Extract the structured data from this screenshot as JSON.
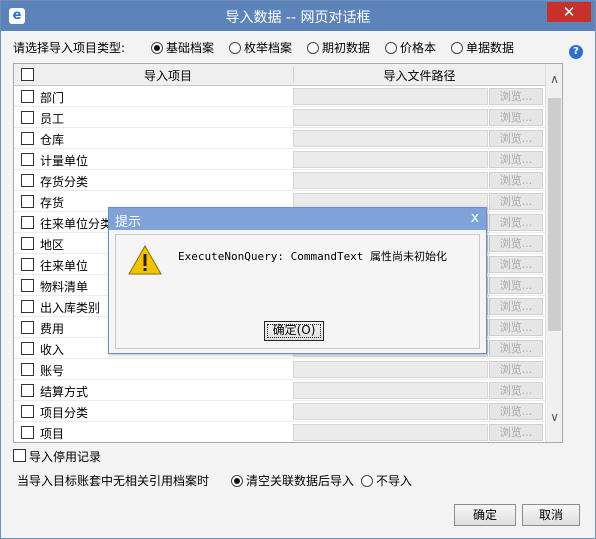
{
  "window": {
    "title": "导入数据 -- 网页对话框",
    "app_icon": "e",
    "close_glyph": "✕"
  },
  "import_type": {
    "label": "请选择导入项目类型:",
    "options": [
      {
        "label": "基础档案",
        "selected": true
      },
      {
        "label": "枚举档案",
        "selected": false
      },
      {
        "label": "期初数据",
        "selected": false
      },
      {
        "label": "价格本",
        "selected": false
      },
      {
        "label": "单据数据",
        "selected": false
      }
    ],
    "help_glyph": "?"
  },
  "grid": {
    "col_item": "导入项目",
    "col_path": "导入文件路径",
    "browse_label": "浏览...",
    "rows": [
      "部门",
      "员工",
      "仓库",
      "计量单位",
      "存货分类",
      "存货",
      "往来单位分类",
      "地区",
      "往来单位",
      "物料清单",
      "出入库类别",
      "费用",
      "收入",
      "账号",
      "结算方式",
      "项目分类",
      "项目"
    ]
  },
  "footer": {
    "import_disabled": "导入停用记录",
    "no_ref_label": "当导入目标账套中无相关引用档案时",
    "opt_clear": "清空关联数据后导入",
    "opt_skip": "不导入",
    "ok": "确定",
    "cancel": "取消"
  },
  "alert": {
    "title": "提示",
    "close_glyph": "x",
    "message": "ExecuteNonQuery: CommandText 属性尚未初始化",
    "ok": "确定(O)"
  },
  "colors": {
    "titlebar": "#5d84ba",
    "close": "#c7312b",
    "alert_title": "#7fa2d8",
    "warning": "#f2c200"
  }
}
